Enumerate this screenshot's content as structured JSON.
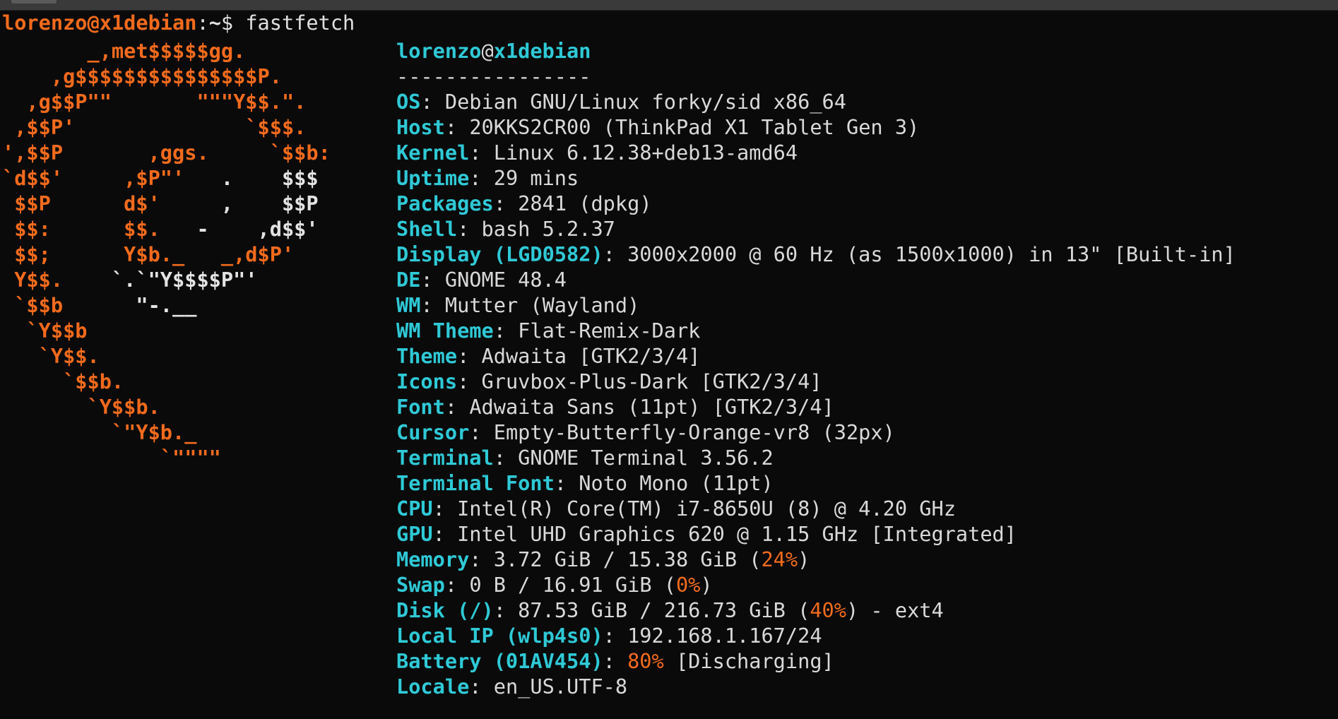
{
  "prompt": {
    "user": "lorenzo",
    "at": "@",
    "host": "x1debian",
    "colon": ":",
    "path": "~",
    "dollar": "$",
    "command": " fastfetch"
  },
  "logo": {
    "lines": [
      [
        "",
        "       _,met$$$$$gg.",
        ""
      ],
      [
        "",
        "    ,g$$$$$$$$$$$$$$$P.",
        ""
      ],
      [
        "",
        "  ,g$$P\"\"       \"\"\"Y$$.\".",
        ""
      ],
      [
        "",
        " ,$$P'              `$$$.",
        ""
      ],
      [
        "",
        "',$$P       ,ggs.     `$$b:",
        ""
      ],
      [
        "",
        "`d$$'     ,$P\"'   ",
        ".    $$$"
      ],
      [
        "",
        " $$P      d$'     ",
        ",    $$P"
      ],
      [
        "",
        " $$:      $$.   ",
        "-    ,d$$'"
      ],
      [
        "",
        " $$;      Y$b._   _,d$P'",
        ""
      ],
      [
        "",
        " Y$$.    ",
        "`.`\"Y$$$$P\"'",
        ""
      ],
      [
        "",
        " `$$b      ",
        "\"-.__",
        ""
      ],
      [
        "",
        "  `Y$$b",
        "",
        ""
      ],
      [
        "",
        "   `Y$$.",
        "",
        ""
      ],
      [
        "",
        "     `$$b.",
        "",
        ""
      ],
      [
        "",
        "       `Y$$b.",
        "",
        ""
      ],
      [
        "",
        "         `\"Y$b._",
        "",
        ""
      ],
      [
        "",
        "             `\"\"\"\"",
        "",
        ""
      ]
    ]
  },
  "info": {
    "user": "lorenzo",
    "at": "@",
    "host": "x1debian",
    "separator": "----------------",
    "rows": [
      {
        "key": "OS",
        "value": "Debian GNU/Linux forky/sid x86_64"
      },
      {
        "key": "Host",
        "value": "20KKS2CR00 (ThinkPad X1 Tablet Gen 3)"
      },
      {
        "key": "Kernel",
        "value": "Linux 6.12.38+deb13-amd64"
      },
      {
        "key": "Uptime",
        "value": "29 mins"
      },
      {
        "key": "Packages",
        "value": "2841 (dpkg)"
      },
      {
        "key": "Shell",
        "value": "bash 5.2.37"
      },
      {
        "key": "Display (LGD0582)",
        "value": "3000x2000 @ 60 Hz (as 1500x1000) in 13\" [Built-in]"
      },
      {
        "key": "DE",
        "value": "GNOME 48.4"
      },
      {
        "key": "WM",
        "value": "Mutter (Wayland)"
      },
      {
        "key": "WM Theme",
        "value": "Flat-Remix-Dark"
      },
      {
        "key": "Theme",
        "value": "Adwaita [GTK2/3/4]"
      },
      {
        "key": "Icons",
        "value": "Gruvbox-Plus-Dark [GTK2/3/4]"
      },
      {
        "key": "Font",
        "value": "Adwaita Sans (11pt) [GTK2/3/4]"
      },
      {
        "key": "Cursor",
        "value": "Empty-Butterfly-Orange-vr8 (32px)"
      },
      {
        "key": "Terminal",
        "value": "GNOME Terminal 3.56.2"
      },
      {
        "key": "Terminal Font",
        "value": "Noto Mono (11pt)"
      },
      {
        "key": "CPU",
        "value": "Intel(R) Core(TM) i7-8650U (8) @ 4.20 GHz"
      },
      {
        "key": "GPU",
        "value": "Intel UHD Graphics 620 @ 1.15 GHz [Integrated]"
      }
    ],
    "memory": {
      "key": "Memory",
      "pre": "3.72 GiB / 15.38 GiB (",
      "pct": "24%",
      "post": ")"
    },
    "swap": {
      "key": "Swap",
      "pre": "0 B / 16.91 GiB (",
      "pct": "0%",
      "post": ")"
    },
    "disk": {
      "key": "Disk (/)",
      "pre": "87.53 GiB / 216.73 GiB (",
      "pct": "40%",
      "post": ") - ext4"
    },
    "localip": {
      "key": "Local IP (wlp4s0)",
      "value": "192.168.1.167/24"
    },
    "battery": {
      "key": "Battery (01AV454)",
      "pct": "80%",
      "post": " [Discharging]"
    },
    "locale": {
      "key": "Locale",
      "value": "en_US.UTF-8"
    },
    "colon": ": "
  },
  "colors": {
    "orange": "#f26b1d",
    "cyan": "#2fc9d6",
    "text": "#d9d9d9",
    "background": "#0a0a0a"
  }
}
